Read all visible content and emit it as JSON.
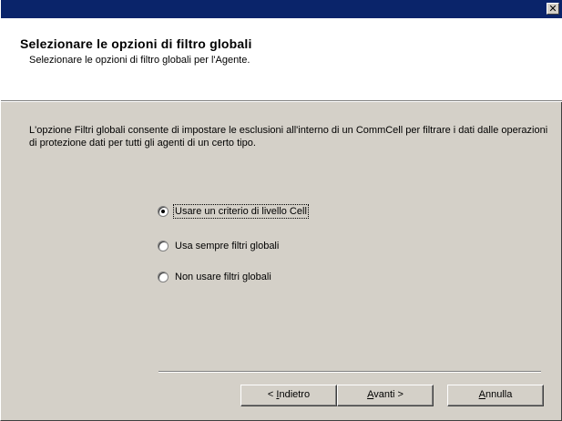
{
  "window": {
    "close_glyph": "✕"
  },
  "header": {
    "title": "Selezionare le opzioni di filtro globali",
    "subtitle": "Selezionare le opzioni di filtro globali per l'Agente."
  },
  "description": "L'opzione Filtri globali consente di impostare le esclusioni all'interno di un CommCell per filtrare i dati dalle operazioni di protezione dati per tutti gli agenti di un certo tipo.",
  "options": {
    "selected_index": 0,
    "items": [
      {
        "label": "Usare un criterio di livello Cell"
      },
      {
        "label": "Usa sempre filtri globali"
      },
      {
        "label": "Non usare filtri globali"
      }
    ]
  },
  "buttons": {
    "back": {
      "prefix": "< ",
      "mnemonic": "I",
      "rest": "ndietro"
    },
    "next": {
      "mnemonic": "A",
      "rest": "vanti >"
    },
    "cancel": {
      "mnemonic": "A",
      "rest": "nnulla"
    }
  },
  "colors": {
    "titlebar": "#0a246a",
    "dialog_bg": "#d4d0c8",
    "header_bg": "#ffffff"
  }
}
